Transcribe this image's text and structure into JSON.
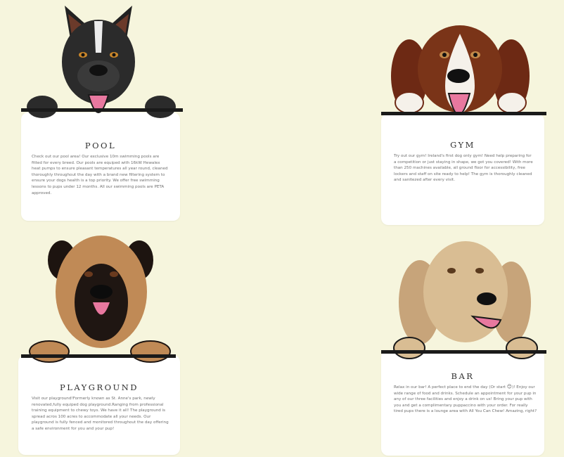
{
  "cards": [
    {
      "title": "POOL",
      "dog_icon": "black-pitbull-dog-icon",
      "description": "Check out our pool area! Our exclusive 10m swimming pools are fitted for every breed. Our pools are equiped with 16kW Hewalex heat pumps to ensure pleasant temperatures all year round, cleaned thoroughly throughout the day with a brand new filtering system to ensure your dogs health is a top priority. We offer free swimming lessons to pups under 12 months. All our swimming pools are PETA approved."
    },
    {
      "title": "GYM",
      "dog_icon": "spaniel-dog-icon",
      "description": "Try out our gym! Ireland's first dog only gym! Need help preparing for a competition or just staying in shape, we got you covered! With more than 250 machines available, all ground floor for accessibility, free lockers and staff on site ready to help! The gym is thoroughly cleaned and sanitezed after every visit."
    },
    {
      "title": "PLAYGROUND",
      "dog_icon": "mastiff-dog-icon",
      "description": "Visit our playground!Formerly known as St. Anne's park, newly renovated,fully equiped dog playground.Ranging from professional training equipment to chewy toys. We have it all! The playground is spread acros 100 acres to accommodate all your needs. Our playground is fully fenced and monitored throughout the day offering a safe environment for you and your pup!"
    },
    {
      "title": "BAR",
      "dog_icon": "golden-retriever-dog-icon",
      "description_before": "Relax in our bar! A perfect place to end the day (Or start",
      "emoji": "😊",
      "description_after": ")! Enjoy our wide range of food and drinks. Schedule an appointment for your pup in any of our three facilities and enjoy a drink on us! Bring your pup with you and get a complimentary puppaccino with your order. For really tired pups there is a lounge area with All You Can Chew! Amazing, right?"
    }
  ],
  "colors": {
    "background": "#f6f5dd",
    "card": "#ffffff",
    "rail": "#1a1a1a",
    "tongue": "#e8789f"
  }
}
